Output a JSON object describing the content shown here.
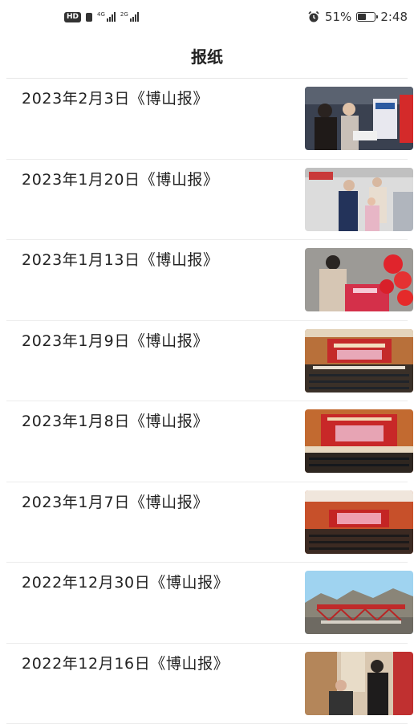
{
  "status_bar": {
    "left_badges": [
      "HD"
    ],
    "network_1": "4G",
    "network_2": "2G",
    "battery_percent": "51%",
    "battery_level": 0.51,
    "time": "2:48",
    "alarm_icon": "alarm-icon"
  },
  "header": {
    "title": "报纸"
  },
  "items": [
    {
      "title": "2023年2月3日《博山报》",
      "thumbnail": "news-photo-crowd-handout"
    },
    {
      "title": "2023年1月20日《博山报》",
      "thumbnail": "news-photo-volunteer-child"
    },
    {
      "title": "2023年1月13日《博山报》",
      "thumbnail": "news-photo-spring-couplets"
    },
    {
      "title": "2023年1月9日《博山报》",
      "thumbnail": "news-photo-conference-hall"
    },
    {
      "title": "2023年1月8日《博山报》",
      "thumbnail": "news-photo-conference-stage"
    },
    {
      "title": "2023年1月7日《博山报》",
      "thumbnail": "news-photo-conference-wide"
    },
    {
      "title": "2022年12月30日《博山报》",
      "thumbnail": "news-photo-bridge-crane"
    },
    {
      "title": "2022年12月16日《博山报》",
      "thumbnail": "news-photo-indoor-visit"
    }
  ]
}
